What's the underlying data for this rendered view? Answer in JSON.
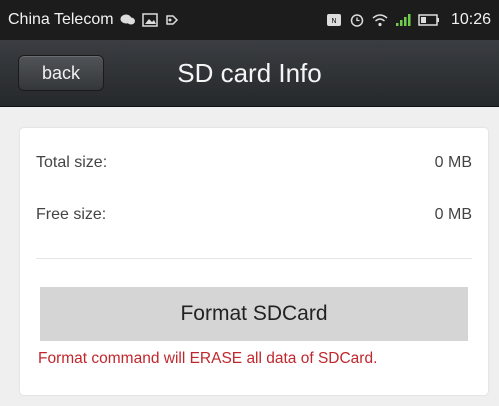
{
  "status_bar": {
    "carrier": "China Telecom",
    "time": "10:26",
    "icons_left": [
      "chat-icon",
      "image-icon",
      "usb-icon"
    ],
    "icons_right": [
      "nfc-icon",
      "alarm-icon",
      "wifi-icon",
      "signal-icon",
      "battery-icon"
    ]
  },
  "header": {
    "back_label": "back",
    "title": "SD card Info"
  },
  "info": {
    "total_label": "Total size:",
    "total_value": "0 MB",
    "free_label": "Free size:",
    "free_value": "0 MB"
  },
  "actions": {
    "format_label": "Format SDCard",
    "warning": "Format command will ERASE all data of SDCard."
  },
  "colors": {
    "warning_text": "#c0272d",
    "nav_bar": "#2e3135",
    "status_bar": "#1c1c1c",
    "button": "#d5d5d5"
  }
}
